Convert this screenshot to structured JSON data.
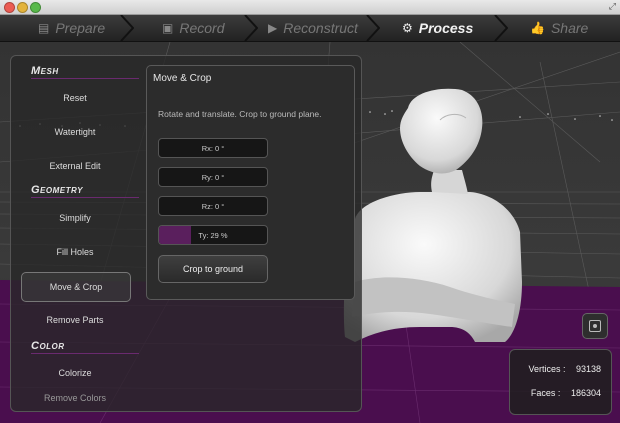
{
  "steps": [
    {
      "label": "Prepare",
      "icon": "prepare-icon"
    },
    {
      "label": "Record",
      "icon": "record-icon"
    },
    {
      "label": "Reconstruct",
      "icon": "reconstruct-icon"
    },
    {
      "label": "Process",
      "icon": "gears-icon",
      "active": true
    },
    {
      "label": "Share",
      "icon": "thumbs-up-icon"
    }
  ],
  "sidebar": {
    "mesh_header": "Mesh",
    "mesh_items": [
      "Reset",
      "Watertight",
      "External Edit"
    ],
    "geometry_header": "Geometry",
    "geometry_items": [
      "Simplify",
      "Fill Holes",
      "Move & Crop",
      "Remove Parts"
    ],
    "color_header": "Color",
    "color_items": [
      "Colorize",
      "Remove Colors"
    ],
    "active_item": "Move & Crop"
  },
  "move_crop": {
    "title": "Move & Crop",
    "description": "Rotate and translate. Crop to ground plane.",
    "rx": "Rx: 0 °",
    "ry": "Ry: 0 °",
    "rz": "Rz: 0 °",
    "ty": "Ty: 29 %",
    "ty_fraction": 0.3,
    "crop_button": "Crop to ground"
  },
  "stats": {
    "vertices_label": "Vertices :",
    "vertices_value": "93138",
    "faces_label": "Faces :",
    "faces_value": "186304"
  },
  "colors": {
    "ground": "#4a0e4e",
    "accent": "#5a1f5d",
    "model": "#e2e2e2"
  }
}
